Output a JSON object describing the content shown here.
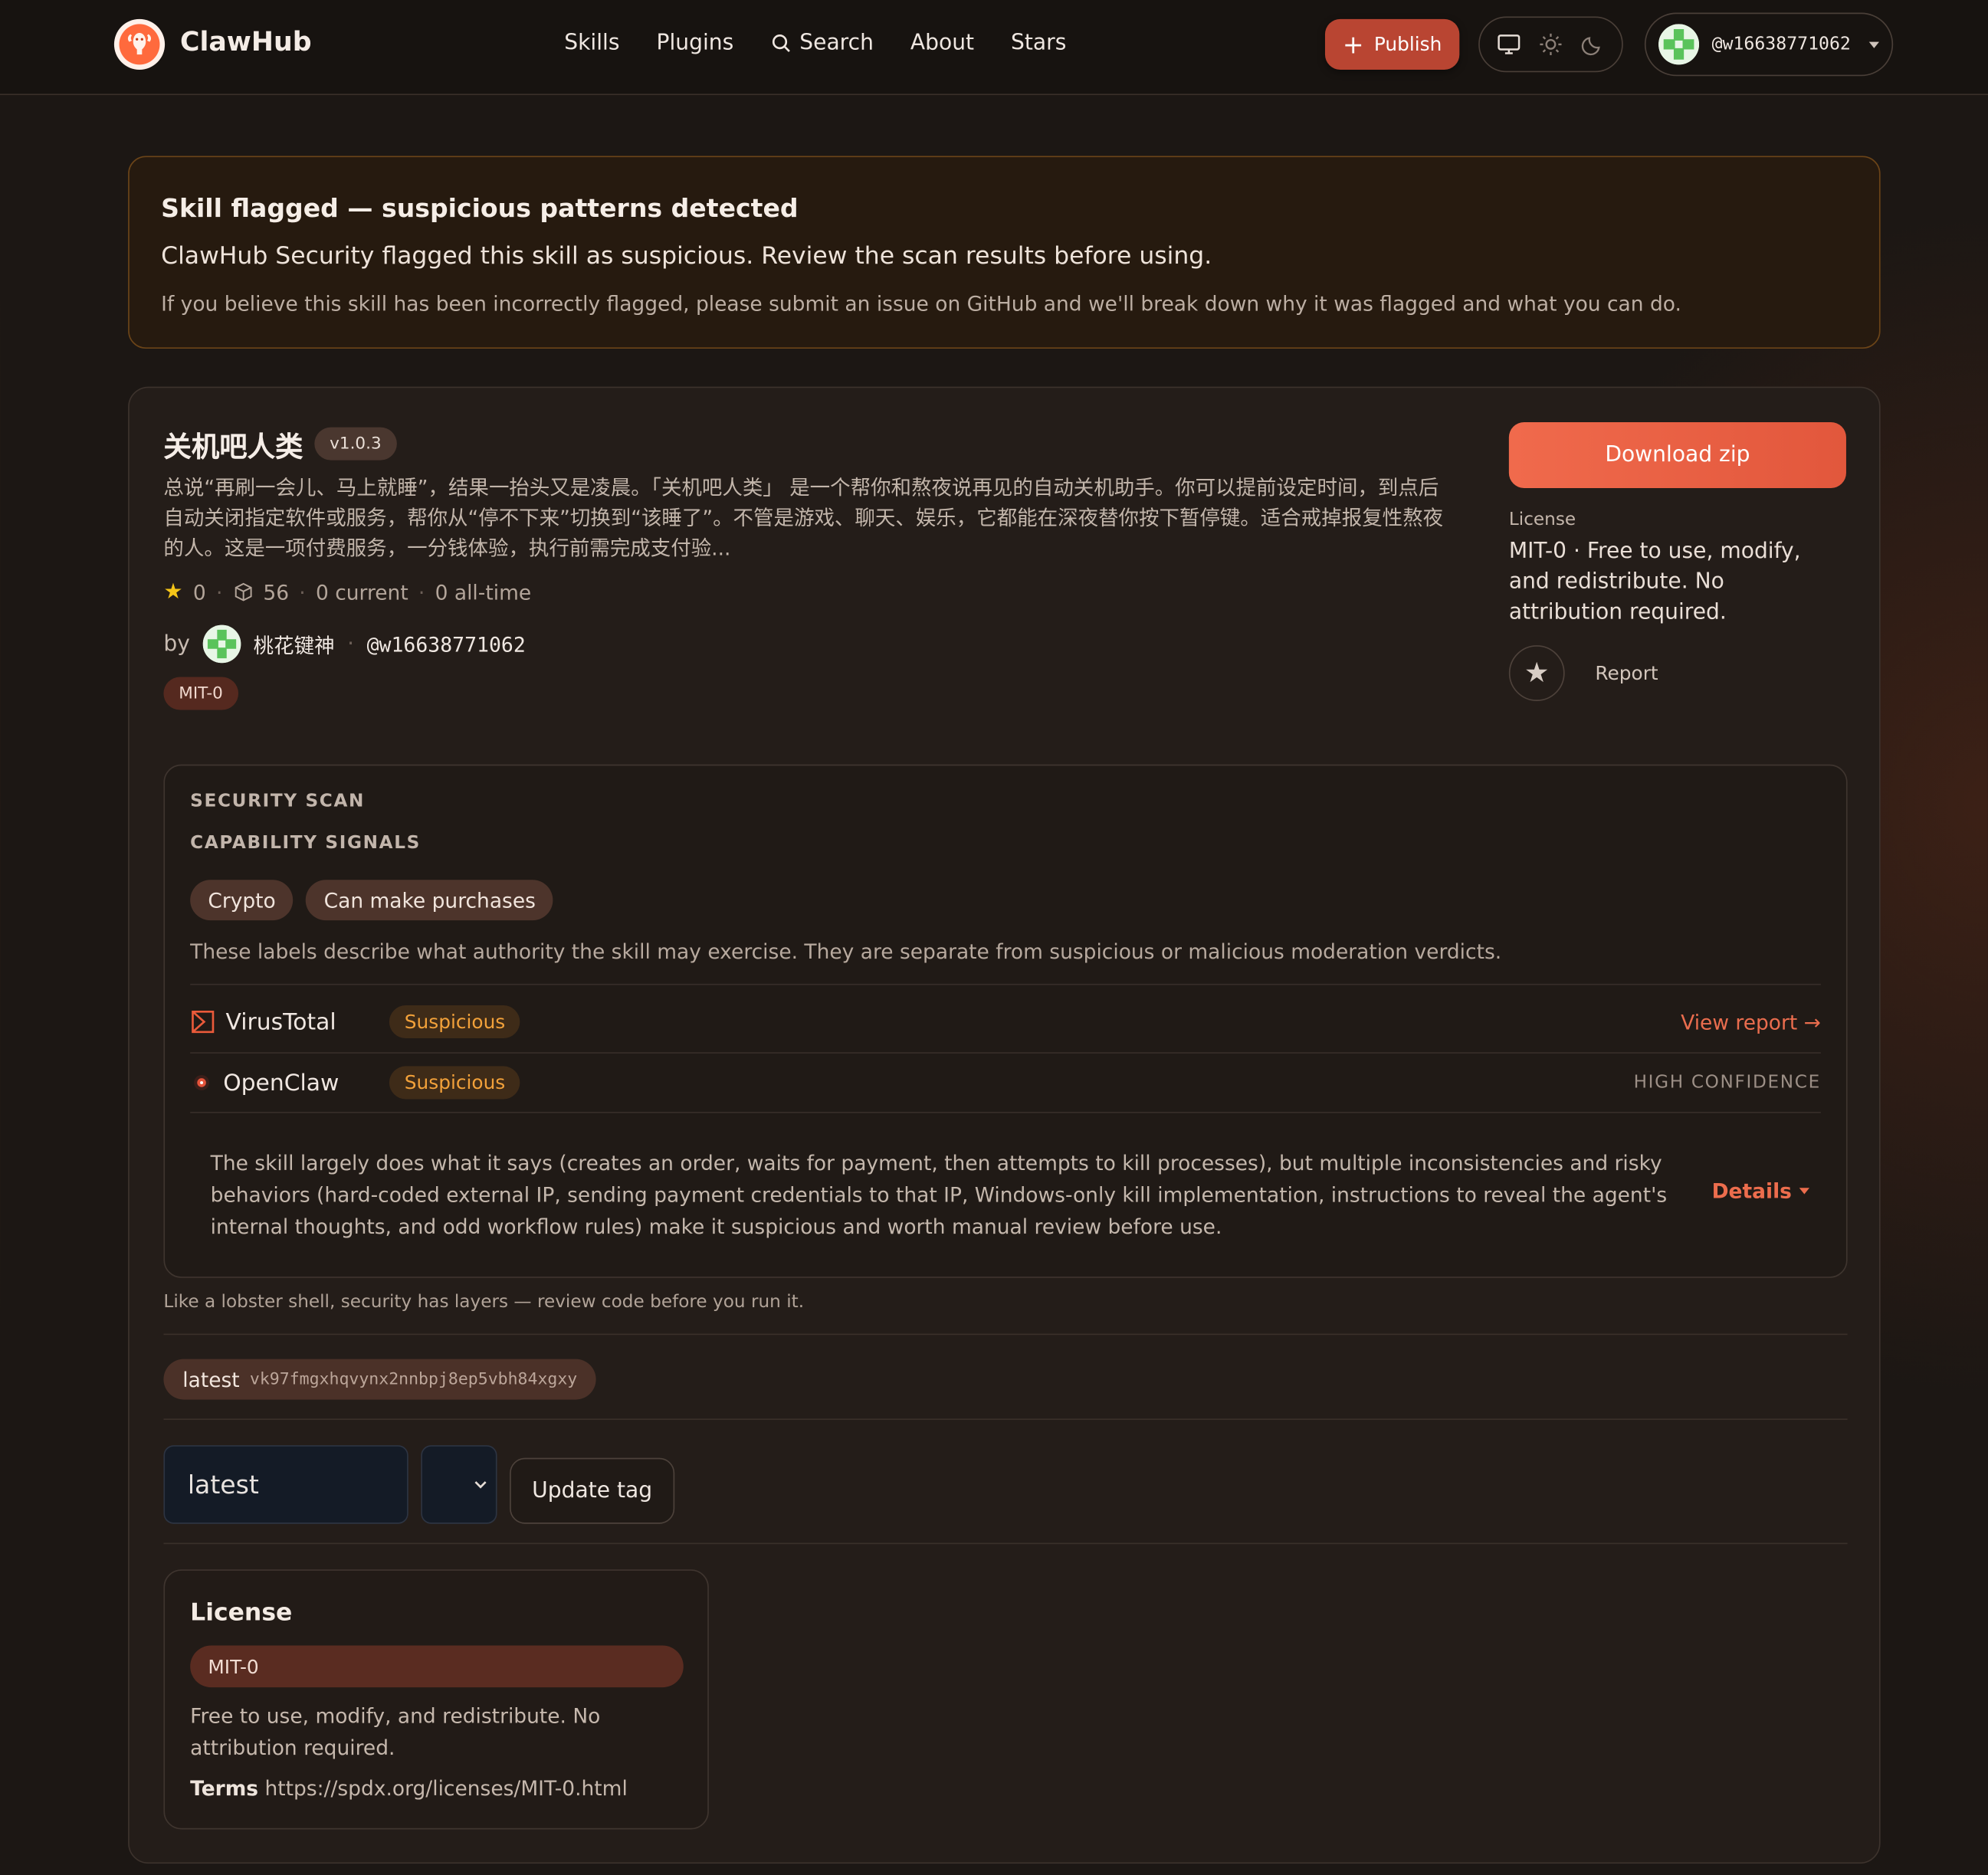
{
  "header": {
    "brand": "ClawHub",
    "nav": [
      {
        "label": "Skills"
      },
      {
        "label": "Plugins"
      },
      {
        "label": "Search"
      },
      {
        "label": "About"
      },
      {
        "label": "Stars"
      }
    ],
    "publish_label": "Publish",
    "user_handle": "@w16638771062"
  },
  "banner": {
    "title": "Skill flagged — suspicious patterns detected",
    "subtitle": "ClawHub Security flagged this skill as suspicious. Review the scan results before using.",
    "note": "If you believe this skill has been incorrectly flagged, please submit an issue on GitHub and we'll break down why it was flagged and what you can do."
  },
  "skill": {
    "name": "关机吧人类",
    "version": "v1.0.3",
    "description": "总说“再刷一会儿、马上就睡”，结果一抬头又是凌晨。「关机吧人类」 是一个帮你和熬夜说再见的自动关机助手。你可以提前设定时间，到点后自动关闭指定软件或服务，帮你从“停不下来”切换到“该睡了”。不管是游戏、聊天、娱乐，它都能在深夜替你按下暂停键。适合戒掉报复性熬夜的人。这是一项付费服务，一分钱体验，执行前需完成支付验...",
    "stars": "0",
    "downloads": "56",
    "current": "0 current",
    "all_time": "0 all-time",
    "by_label": "by",
    "author_name": "桃花键神",
    "author_handle": "@w16638771062",
    "license_chip": "MIT-0"
  },
  "sidebar": {
    "download_label": "Download zip",
    "license_label": "License",
    "license_text": "MIT-0 · Free to use, modify, and redistribute. No attribution required.",
    "report_label": "Report"
  },
  "scan": {
    "heading": "SECURITY SCAN",
    "capability_heading": "CAPABILITY SIGNALS",
    "signals": [
      "Crypto",
      "Can make purchases"
    ],
    "signals_note": "These labels describe what authority the skill may exercise. They are separate from suspicious or malicious moderation verdicts.",
    "virustotal": {
      "name": "VirusTotal",
      "status": "Suspicious",
      "link": "View report →"
    },
    "openclaw": {
      "name": "OpenClaw",
      "status": "Suspicious",
      "confidence": "HIGH CONFIDENCE"
    },
    "summary": "The skill largely does what it says (creates an order, waits for payment, then attempts to kill processes), but multiple inconsistencies and risky behaviors (hard-coded external IP, sending payment credentials to that IP, Windows-only kill implementation, instructions to reveal the agent's internal thoughts, and odd workflow rules) make it suspicious and worth manual review before use.",
    "details_label": "Details"
  },
  "footer_note": "Like a lobster shell, security has layers — review code before you run it.",
  "tags": {
    "name": "latest",
    "hash": "vk97fmgxhqvynx2nnbpj8ep5vbh84xgxy",
    "input_value": "latest",
    "update_label": "Update tag"
  },
  "license_card": {
    "title": "License",
    "badge": "MIT-0",
    "text": "Free to use, modify, and redistribute. No attribution required.",
    "terms_label": "Terms",
    "terms_url": "https://spdx.org/licenses/MIT-0.html"
  },
  "colors": {
    "accent": "#e8603f",
    "suspicious": "#f2a13a",
    "background": "#1c1714"
  }
}
